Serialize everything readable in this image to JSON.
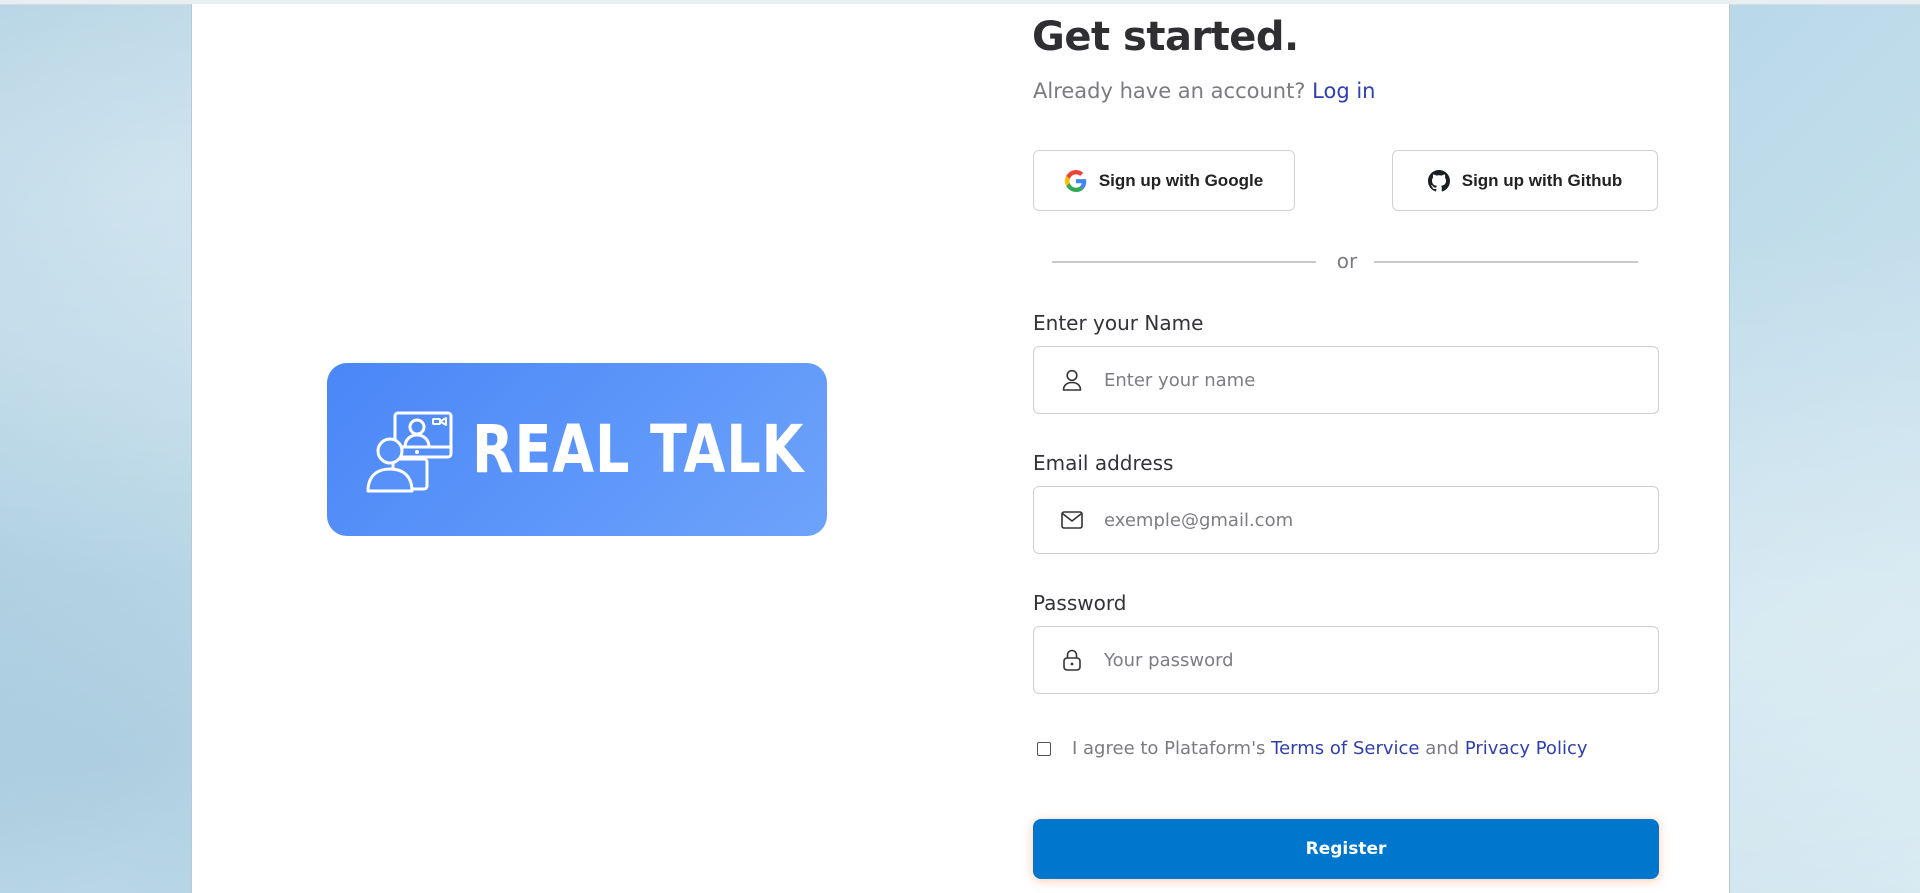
{
  "brand": {
    "name": "REAL TALK",
    "color": "#4a86f7"
  },
  "form": {
    "title": "Get started.",
    "subtitle_text": "Already have an account?",
    "login_link": "Log in",
    "google_button": "Sign up with Google",
    "github_button": "Sign up with Github",
    "divider_text": "or",
    "name_label": "Enter your Name",
    "name_placeholder": "Enter your name",
    "email_label": "Email address",
    "email_placeholder": "exemple@gmail.com",
    "password_label": "Password",
    "password_placeholder": "Your password",
    "agree_prefix": "I agree to Plataform's",
    "terms_link": "Terms of Service",
    "agree_and": "and",
    "privacy_link": "Privacy Policy",
    "agree_checked": false,
    "register_button": "Register"
  },
  "icons": {
    "google": "google-icon",
    "github": "github-icon",
    "user": "user-icon",
    "mail": "mail-icon",
    "lock": "lock-icon"
  },
  "colors": {
    "link": "#2f3fb0",
    "primary_button": "#0077cc"
  }
}
